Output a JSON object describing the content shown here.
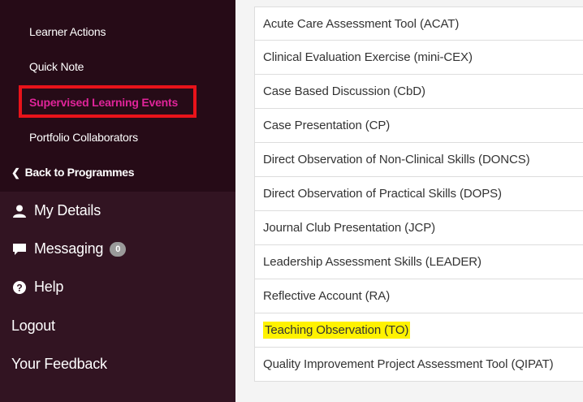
{
  "sidebar": {
    "sub_items": [
      {
        "label": "Learner Actions"
      },
      {
        "label": "Quick Note"
      },
      {
        "label": "Supervised Learning Events",
        "active": true
      },
      {
        "label": "Portfolio Collaborators"
      }
    ],
    "back_link": {
      "label": "Back to Programmes",
      "icon": "chevron-left-icon"
    },
    "main_items": [
      {
        "label": "My Details",
        "icon": "user-icon"
      },
      {
        "label": "Messaging",
        "icon": "chat-icon",
        "badge": "0"
      },
      {
        "label": "Help",
        "icon": "question-icon"
      },
      {
        "label": "Logout"
      },
      {
        "label": "Your Feedback"
      }
    ]
  },
  "list": {
    "items": [
      "Acute Care Assessment Tool (ACAT)",
      "Clinical Evaluation Exercise (mini-CEX)",
      "Case Based Discussion (CbD)",
      "Case Presentation (CP)",
      "Direct Observation of Non-Clinical Skills (DONCS)",
      "Direct Observation of Practical Skills (DOPS)",
      "Journal Club Presentation (JCP)",
      "Leadership Assessment Skills (LEADER)",
      "Reflective Account (RA)",
      "Teaching Observation (TO)",
      "Quality Improvement Project Assessment Tool (QIPAT)"
    ],
    "highlighted_index": 9
  },
  "colors": {
    "sidebar_bg": "#321422",
    "submenu_bg": "#260b17",
    "active_text": "#e0249a",
    "active_outline": "#e8131a",
    "highlight": "#fff200"
  }
}
